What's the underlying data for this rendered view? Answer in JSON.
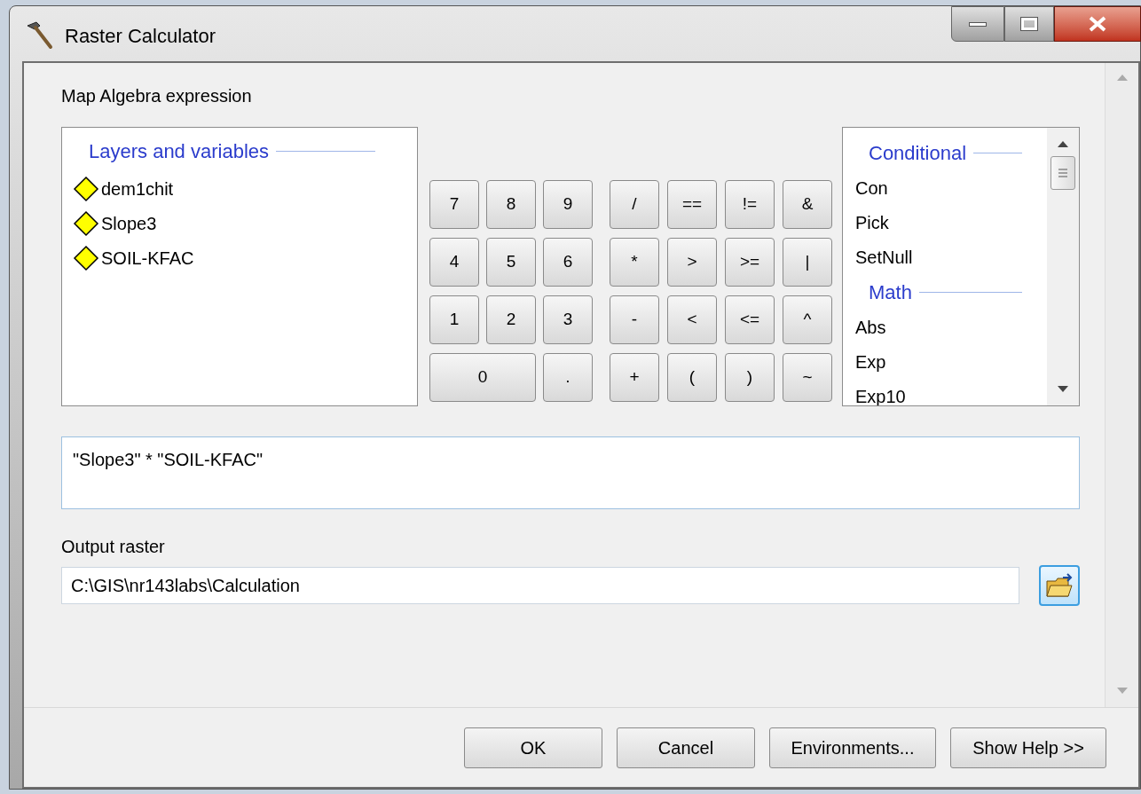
{
  "window": {
    "title": "Raster Calculator"
  },
  "expression_label": "Map Algebra expression",
  "layers": {
    "header": "Layers and variables",
    "items": [
      "dem1chit",
      "Slope3",
      "SOIL-KFAC"
    ]
  },
  "digit_keys": [
    [
      {
        "label": "7",
        "kind": "normal"
      },
      {
        "label": "8",
        "kind": "normal"
      },
      {
        "label": "9",
        "kind": "normal"
      }
    ],
    [
      {
        "label": "4",
        "kind": "normal"
      },
      {
        "label": "5",
        "kind": "normal"
      },
      {
        "label": "6",
        "kind": "normal"
      }
    ],
    [
      {
        "label": "1",
        "kind": "normal"
      },
      {
        "label": "2",
        "kind": "normal"
      },
      {
        "label": "3",
        "kind": "normal"
      }
    ],
    [
      {
        "label": "0",
        "kind": "wide"
      },
      {
        "label": ".",
        "kind": "normal"
      }
    ]
  ],
  "operator_keys": [
    [
      "/",
      "==",
      "!=",
      "&"
    ],
    [
      "*",
      ">",
      ">=",
      "|"
    ],
    [
      "-",
      "<",
      "<=",
      "^"
    ],
    [
      "+",
      "(",
      ")",
      "~"
    ]
  ],
  "functions": [
    {
      "kind": "header",
      "label": "Conditional"
    },
    {
      "kind": "item",
      "label": "Con"
    },
    {
      "kind": "item",
      "label": "Pick"
    },
    {
      "kind": "item",
      "label": "SetNull"
    },
    {
      "kind": "header",
      "label": "Math"
    },
    {
      "kind": "item",
      "label": "Abs"
    },
    {
      "kind": "item",
      "label": "Exp"
    },
    {
      "kind": "item",
      "label": "Exp10"
    }
  ],
  "expression": "\"Slope3\" * \"SOIL-KFAC\"",
  "output": {
    "label": "Output raster",
    "value": "C:\\GIS\\nr143labs\\Calculation"
  },
  "buttons": [
    "OK",
    "Cancel",
    "Environments...",
    "Show Help >>"
  ]
}
